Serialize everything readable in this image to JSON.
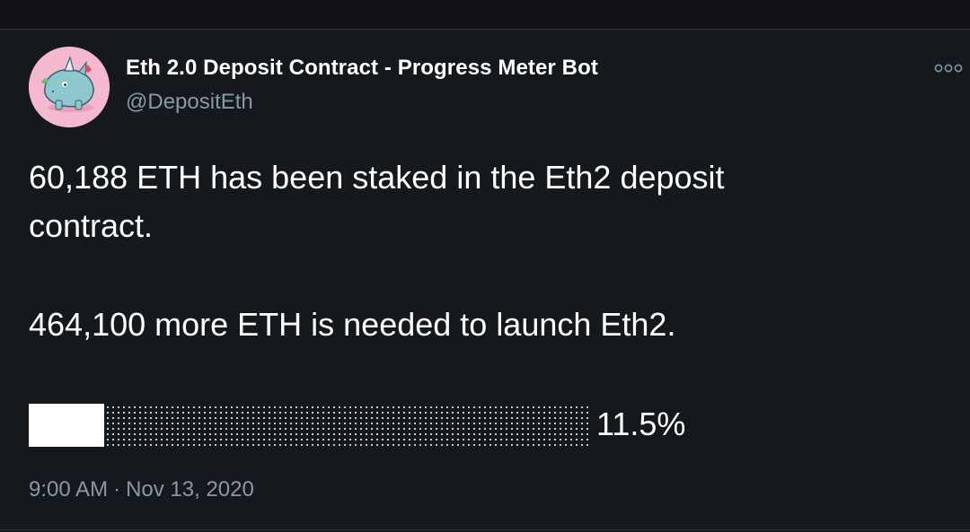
{
  "author": {
    "display_name": "Eth 2.0 Deposit Contract - Progress Meter Bot",
    "handle": "@DepositEth",
    "avatar_icon": "rhino-avatar-icon",
    "avatar_bg": "#f4b8cf"
  },
  "menu": {
    "icon": "more-options-icon"
  },
  "tweet": {
    "line1": "60,188 ETH has been staked in the Eth2 deposit",
    "line2": "contract.",
    "line3": "464,100 more ETH is needed to launch Eth2.",
    "progress_fraction": 0.115,
    "progress_label": "11.5%"
  },
  "timestamp": {
    "time": "9:00 AM",
    "separator": "·",
    "date": "Nov 13, 2020"
  },
  "colors": {
    "background": "#15181c",
    "text_primary": "#ffffff",
    "text_secondary": "#8899a6",
    "avatar_bg": "#f4b8cf"
  }
}
